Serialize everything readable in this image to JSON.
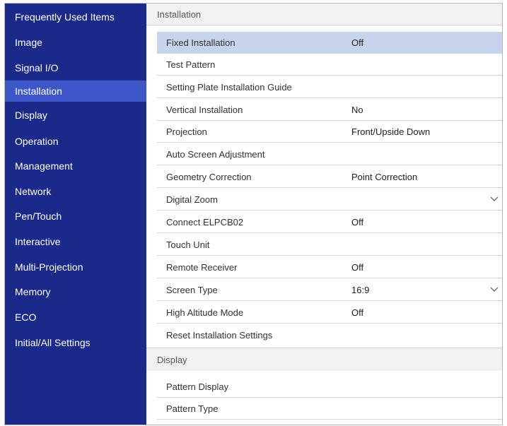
{
  "sidebar": {
    "items": [
      {
        "label": "Frequently Used Items",
        "active": false
      },
      {
        "label": "Image",
        "active": false
      },
      {
        "label": "Signal I/O",
        "active": false
      },
      {
        "label": "Installation",
        "active": true
      },
      {
        "label": "Display",
        "active": false
      },
      {
        "label": "Operation",
        "active": false
      },
      {
        "label": "Management",
        "active": false
      },
      {
        "label": "Network",
        "active": false
      },
      {
        "label": "Pen/Touch",
        "active": false
      },
      {
        "label": "Interactive",
        "active": false
      },
      {
        "label": "Multi-Projection",
        "active": false
      },
      {
        "label": "Memory",
        "active": false
      },
      {
        "label": "ECO",
        "active": false
      },
      {
        "label": "Initial/All Settings",
        "active": false
      }
    ]
  },
  "installation": {
    "header": "Installation",
    "rows": [
      {
        "label": "Fixed Installation",
        "value": "Off"
      },
      {
        "label": "Test Pattern",
        "value": ""
      },
      {
        "label": "Setting Plate Installation Guide",
        "value": ""
      },
      {
        "label": "Vertical Installation",
        "value": "No"
      },
      {
        "label": "Projection",
        "value": "Front/Upside Down"
      },
      {
        "label": "Auto Screen Adjustment",
        "value": ""
      },
      {
        "label": "Geometry Correction",
        "value": "Point Correction"
      },
      {
        "label": "Digital Zoom",
        "value": ""
      },
      {
        "label": "Connect ELPCB02",
        "value": "Off"
      },
      {
        "label": "Touch Unit",
        "value": ""
      },
      {
        "label": "Remote Receiver",
        "value": "Off"
      },
      {
        "label": "Screen Type",
        "value": "16:9"
      },
      {
        "label": "High Altitude Mode",
        "value": "Off"
      },
      {
        "label": "Reset Installation Settings",
        "value": ""
      }
    ]
  },
  "display": {
    "header": "Display",
    "rows": [
      {
        "label": "Pattern Display",
        "value": ""
      },
      {
        "label": "Pattern Type",
        "value": ""
      }
    ]
  },
  "colors": {
    "sidebar_bg": "#1b2a8a",
    "sidebar_active": "#3d56c8",
    "row_selected": "#c7d2ec"
  },
  "icons": {
    "expand": "chevron-down-icon"
  }
}
